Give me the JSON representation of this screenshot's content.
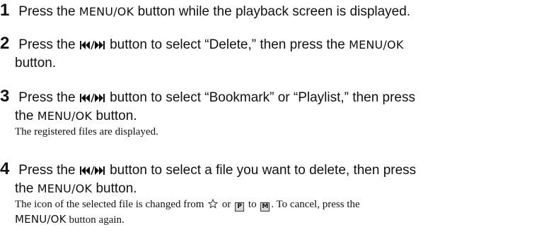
{
  "steps": [
    {
      "number": "1",
      "parts": [
        "Press the",
        "MENU/OK",
        "button while the playback screen is displayed."
      ]
    },
    {
      "number": "2",
      "parts": [
        "Press the",
        "button to select “Delete,” then press the",
        "MENU/OK",
        "button."
      ]
    },
    {
      "number": "3",
      "parts": [
        "Press the",
        "button to select “Bookmark” or “Playlist,” then press",
        "the",
        "MENU/OK",
        "button."
      ],
      "note": "The registered files are displayed."
    },
    {
      "number": "4",
      "parts": [
        "Press the",
        "button to select a file you want to delete, then press",
        "the",
        "MENU/OK",
        "button."
      ],
      "note_parts": [
        "The icon of the selected file is changed from",
        "or",
        "to",
        ". To cancel, press the",
        "MENU/OK",
        "button again."
      ],
      "icons": {
        "bookmark": "star-outline-icon",
        "playlist": "P",
        "marked": "M"
      }
    }
  ],
  "icons": {
    "skip": "skip-back-forward-icon"
  }
}
